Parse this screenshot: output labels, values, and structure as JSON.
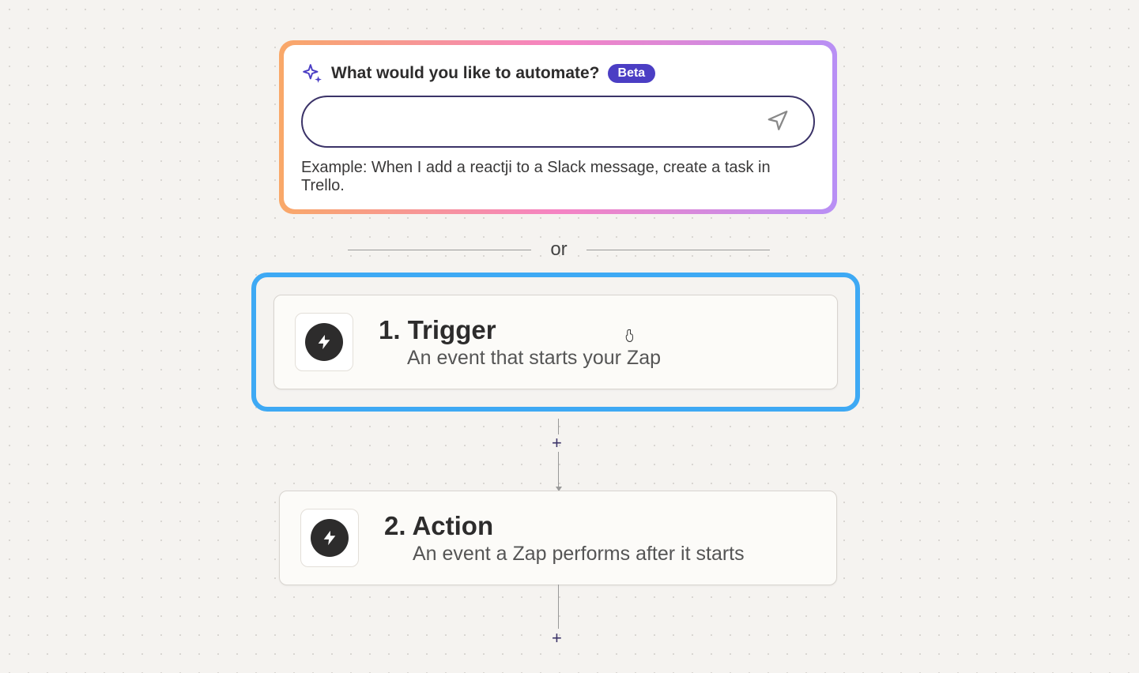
{
  "aiPrompt": {
    "title": "What would you like to automate?",
    "badge": "Beta",
    "inputValue": "",
    "placeholder": "",
    "example": "Example: When I add a reactji to a Slack message, create a task in Trello."
  },
  "divider": {
    "text": "or"
  },
  "steps": {
    "trigger": {
      "title": "1. Trigger",
      "subtitle": "An event that starts your Zap"
    },
    "action": {
      "title": "2. Action",
      "subtitle": "An event a Zap performs after it starts"
    }
  },
  "addStep": {
    "label1": "+",
    "label2": "+"
  }
}
